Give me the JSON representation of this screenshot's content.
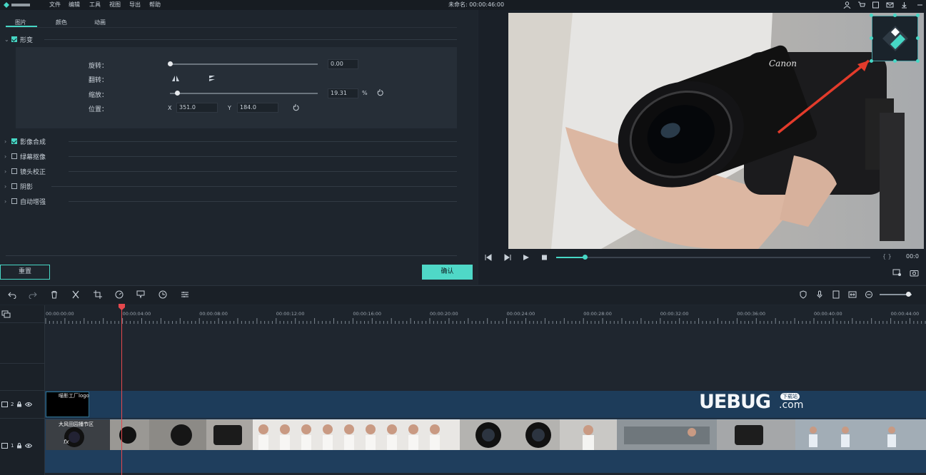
{
  "menubar": {
    "items": [
      "文件",
      "编辑",
      "工具",
      "视图",
      "导出",
      "帮助"
    ],
    "project_title": "未命名: 00:00:46:00"
  },
  "left_panel": {
    "tabs": [
      "图片",
      "颜色",
      "动画"
    ],
    "active_tab": "图片",
    "sections": [
      {
        "label": "形变",
        "checked": true,
        "expanded": true
      },
      {
        "label": "影像合成",
        "checked": true,
        "expanded": false
      },
      {
        "label": "绿幕抠像",
        "checked": false,
        "expanded": false
      },
      {
        "label": "镜头校正",
        "checked": false,
        "expanded": false
      },
      {
        "label": "阴影",
        "checked": false,
        "expanded": false
      },
      {
        "label": "自动增强",
        "checked": false,
        "expanded": false
      }
    ],
    "transform": {
      "rotate_label": "旋转：",
      "rotate_value": "0.00",
      "rotate_fraction": 0.0,
      "flip_label": "翻转：",
      "scale_label": "缩放：",
      "scale_value": "19.31",
      "scale_unit": "%",
      "scale_fraction": 0.05,
      "position_label": "位置：",
      "x_label": "X",
      "x_value": "351.0",
      "y_label": "Y",
      "y_value": "184.0"
    },
    "reset_button": "重置",
    "ok_button": "确认"
  },
  "preview": {
    "progress_fraction": 0.09,
    "timecode": "00:0",
    "brackets": "{ }"
  },
  "timeline": {
    "ruler_ticks": [
      "00:00:00:00",
      "00:00:04:00",
      "00:00:08:00",
      "00:00:12:00",
      "00:00:16:00",
      "00:00:20:00",
      "00:00:24:00",
      "00:00:28:00",
      "00:00:32:00",
      "00:00:36:00",
      "00:00:40:00",
      "00:00:44:00"
    ],
    "track2_label": "2",
    "track1_label": "1",
    "logo_clip_label": "喵影工厂logo",
    "video_clip_label": "大风田园播节区",
    "fx_label": "fx"
  },
  "watermark": {
    "brand": "UEBUG",
    "suffix": ".com",
    "badge": "下载站"
  },
  "colors": {
    "accent": "#47d7c5",
    "playhead": "#e5484d",
    "track": "#1d3c5a"
  }
}
